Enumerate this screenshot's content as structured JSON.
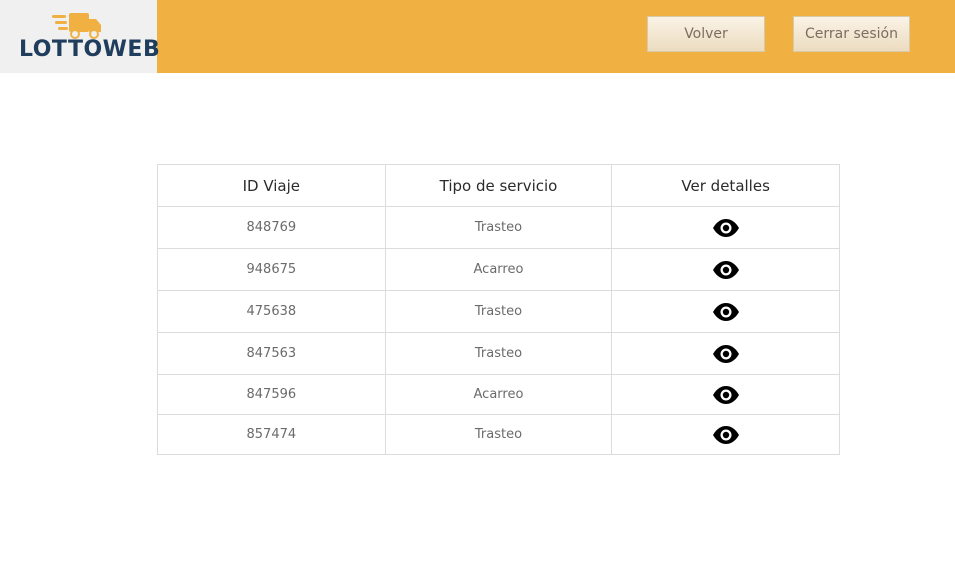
{
  "header": {
    "logo_text": "LOTTOWEB",
    "accent_color": "#f1b142",
    "back_label": "Volver",
    "logout_label": "Cerrar sesión"
  },
  "table": {
    "columns": [
      "ID Viaje",
      "Tipo de servicio",
      "Ver detalles"
    ],
    "rows": [
      {
        "id": "848769",
        "service": "Trasteo",
        "action_icon": "eye-icon"
      },
      {
        "id": "948675",
        "service": "Acarreo",
        "action_icon": "eye-icon"
      },
      {
        "id": "475638",
        "service": "Trasteo",
        "action_icon": "eye-icon"
      },
      {
        "id": "847563",
        "service": "Trasteo",
        "action_icon": "eye-icon"
      },
      {
        "id": "847596",
        "service": "Acarreo",
        "action_icon": "eye-icon"
      },
      {
        "id": "857474",
        "service": "Trasteo",
        "action_icon": "eye-icon"
      }
    ]
  }
}
